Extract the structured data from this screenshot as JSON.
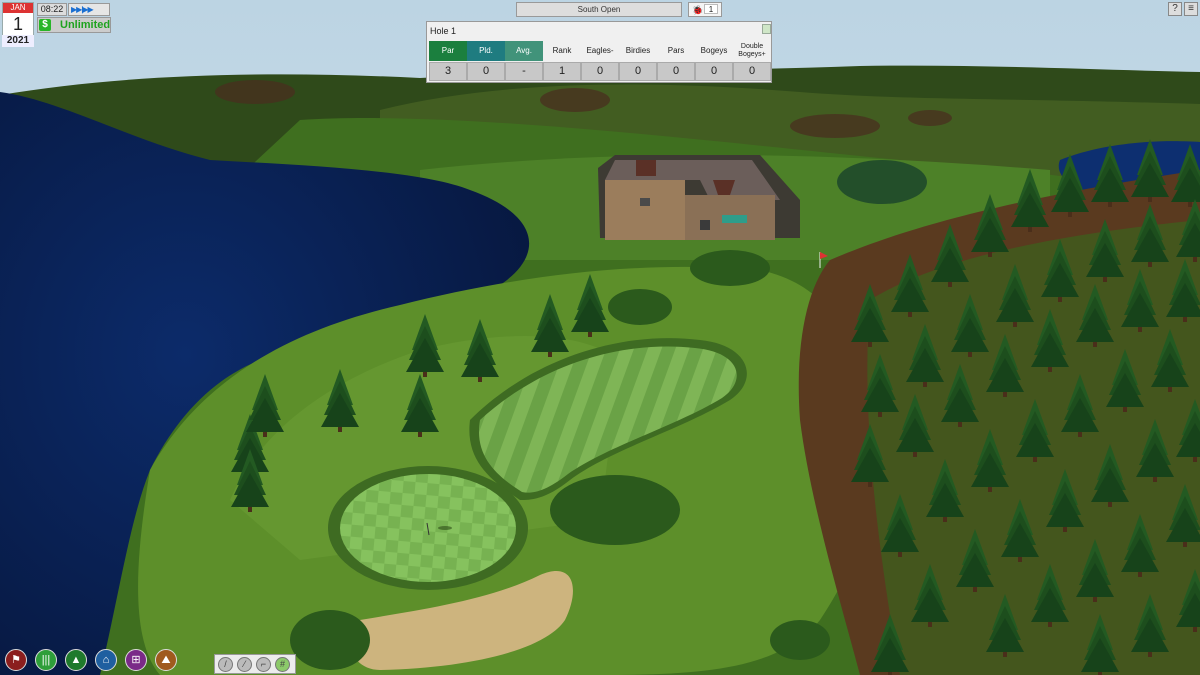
{
  "date": {
    "month": "JAN",
    "day": "1",
    "year": "2021"
  },
  "time": {
    "clock": "08:22",
    "speed_icon": "speed-controls-icon",
    "speed_glyphs": "▶▶|▶▶"
  },
  "money": {
    "icon": "dollar-icon",
    "symbol": "$",
    "value": "Unlimited"
  },
  "course": {
    "name": "South Open"
  },
  "golfers": {
    "icon": "bug-icon",
    "count": "1"
  },
  "top_right": {
    "help": "?",
    "menu": "≡"
  },
  "hole_panel": {
    "title": "Hole 1",
    "columns": [
      {
        "label": "Par",
        "value": "3"
      },
      {
        "label": "Pld.",
        "value": "0"
      },
      {
        "label": "Avg.",
        "value": "-"
      },
      {
        "label": "Rank",
        "value": "1"
      },
      {
        "label": "Eagles-",
        "value": "0"
      },
      {
        "label": "Birdies",
        "value": "0"
      },
      {
        "label": "Pars",
        "value": "0"
      },
      {
        "label": "Bogeys",
        "value": "0"
      },
      {
        "label": "Double Bogeys+",
        "value": "0"
      }
    ]
  },
  "toolbar": {
    "tools": [
      {
        "name": "course-tool",
        "icon": "flag-icon",
        "color": "#8b1e1e"
      },
      {
        "name": "grass-tool",
        "icon": "grass-icon",
        "color": "#2e9e3a"
      },
      {
        "name": "trees-tool",
        "icon": "tree-icon",
        "color": "#1f7a2c"
      },
      {
        "name": "buildings-tool",
        "icon": "house-icon",
        "color": "#1f5fa0"
      },
      {
        "name": "decor-tool",
        "icon": "fence-icon",
        "color": "#7a2a88"
      },
      {
        "name": "terrain-tool",
        "icon": "mountain-icon",
        "color": "#a05a1e"
      }
    ],
    "small_tools": [
      {
        "name": "club-tool",
        "icon": "club-icon"
      },
      {
        "name": "path-tool",
        "icon": "path-icon"
      },
      {
        "name": "shovel-tool",
        "icon": "shovel-icon"
      },
      {
        "name": "grid-tool",
        "icon": "grid-icon"
      }
    ]
  }
}
